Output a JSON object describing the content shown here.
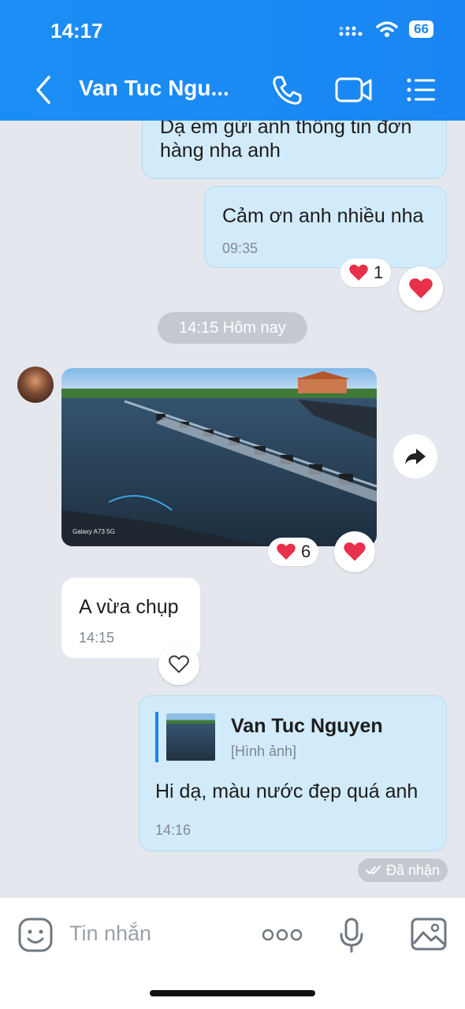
{
  "status_bar": {
    "time": "14:17",
    "battery": "66"
  },
  "header": {
    "title": "Van Tuc Ngu...",
    "back_icon": "chevron-left-icon",
    "call_icon": "phone-icon",
    "video_icon": "video-camera-icon",
    "menu_icon": "list-menu-icon"
  },
  "messages": {
    "m1": {
      "text": "Dạ em gửi anh thông tin đơn hàng nha anh"
    },
    "m2": {
      "text": "Cảm ơn anh nhiều nha",
      "time": "09:35",
      "reaction_count": "1"
    },
    "date_divider": "14:15 Hôm nay",
    "m3": {
      "photo_caption": "Galaxy A73 5G",
      "reaction_count": "6"
    },
    "m4": {
      "text": "A vừa chụp",
      "time": "14:15"
    },
    "m5": {
      "quote_name": "Van Tuc Nguyen",
      "quote_type": "[Hình ảnh]",
      "text": "Hi dạ, màu nước đẹp quá anh",
      "time": "14:16"
    },
    "status": "Đã nhận"
  },
  "composer": {
    "placeholder": "Tin nhắn",
    "more_label": "ooo"
  },
  "colors": {
    "header": "#1a86f3",
    "outgoing_bubble": "#d2ebfb",
    "incoming_bubble": "#ffffff",
    "background": "#e4e8ee",
    "heart": "#e8304a"
  }
}
